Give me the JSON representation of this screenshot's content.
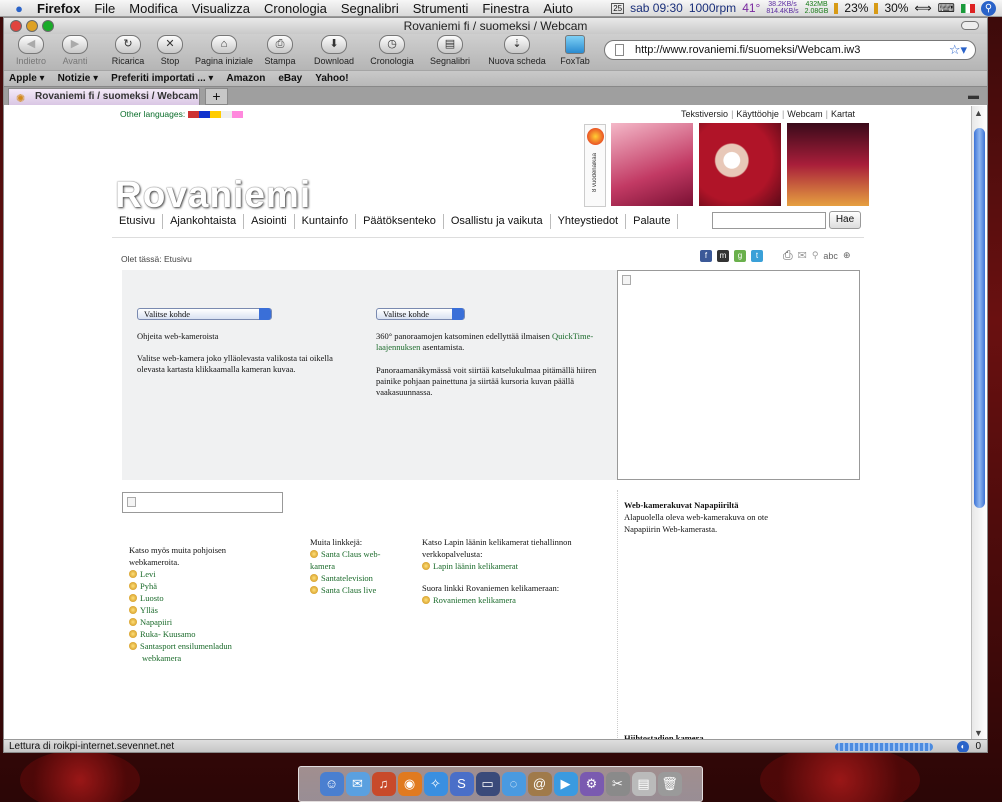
{
  "menubar": {
    "apple": "",
    "items": [
      "Firefox",
      "File",
      "Modifica",
      "Visualizza",
      "Cronologia",
      "Segnalibri",
      "Strumenti",
      "Finestra",
      "Aiuto"
    ],
    "status": {
      "cal_day": "25",
      "datetime": "sab 09:30",
      "rpm": "1000rpm",
      "temp": "41°",
      "net_up": "38.2KB/s",
      "net_down": "814.4KB/s",
      "mem_used": "432MB",
      "mem_free": "2.08GB",
      "cpu1": "23%",
      "cpu2": "30%"
    }
  },
  "window": {
    "title": "Rovaniemi fi / suomeksi / Webcam"
  },
  "toolbar": {
    "back": "Indietro",
    "forward": "Avanti",
    "reload": "Ricarica",
    "stop": "Stop",
    "home": "Pagina iniziale",
    "print": "Stampa",
    "download": "Download",
    "history": "Cronologia",
    "bookmarks": "Segnalibri",
    "newtab": "Nuova scheda",
    "foxtab": "FoxTab",
    "url": "http://www.rovaniemi.fi/suomeksi/Webcam.iw3"
  },
  "bookmarks_bar": [
    "Apple ▾",
    "Notizie ▾",
    "Preferiti importati ... ▾",
    "Amazon",
    "eBay",
    "Yahoo!"
  ],
  "tab": {
    "label": "Rovaniemi fi / suomeksi / Webcam",
    "new": "+"
  },
  "statusbar": {
    "text": "Lettura di roikpi-internet.sevennet.net",
    "count": "0"
  },
  "site": {
    "other_languages": "Other languages:",
    "top_links": [
      "Tekstiversio",
      "Käyttöohje",
      "Webcam",
      "Kartat"
    ],
    "logo_tile_text": "8 vuodenaikaa",
    "title": "Rovaniemi",
    "nav": [
      "Etusivu",
      "Ajankohtaista",
      "Asiointi",
      "Kuntainfo",
      "Päätöksenteko",
      "Osallistu ja vaikuta",
      "Yhteystiedot",
      "Palaute"
    ],
    "search_button": "Hae",
    "breadcrumb": "Olet tässä: Etusivu",
    "share_zoom": "abc",
    "select_left": "Valitse kohde",
    "select_right": "Valitse kohde",
    "left_heading": "Ohjeita web-kameroista",
    "left_text": "Valitse web-kamera joko ylläolevasta valikosta tai oikella olevasta kartasta klikkaamalla kameran kuvaa.",
    "right_text_1a": "360° panoraamojen katsominen edellyttää ilmaisen",
    "right_text_1_link": "QuickTime-laajennuksen",
    "right_text_1b": "asentamista.",
    "right_text_2": "Panoraamanäkymässä voit siirtää katselukulmaa pitämällä hiiren painike pohjaan painettuna ja siirtää kursoria kuvan päällä vaakasuunnassa.",
    "see_also": "Katso myös muita pohjoisen webkameroita.",
    "north_links": [
      "Levi",
      "Pyhä",
      "Luosto",
      "Ylläs",
      "Napapiiri",
      "Ruka- Kuusamo",
      "Santasport ensilumenladun webkamera"
    ],
    "other_links_title": "Muita linkkejä:",
    "other_links": [
      "Santa Claus web-kamera",
      "Santatelevision",
      "Santa Claus live"
    ],
    "lappi_text": "Katso Lapin läänin kelikamerat tiehallinnon verkkopalvelusta:",
    "lappi_link": "Lapin läänin kelikamerat",
    "direct_text": "Suora linkki Rovaniemen kelikameraan:",
    "direct_link": "Rovaniemen kelikamera",
    "napa_title": "Web-kamerakuvat Napapiiriltä",
    "napa_text": "Alapuolella oleva web-kamerakuva on ote Napapiirin Web-kamerasta.",
    "hiihto_title": "Hiihtostadion kamera"
  }
}
